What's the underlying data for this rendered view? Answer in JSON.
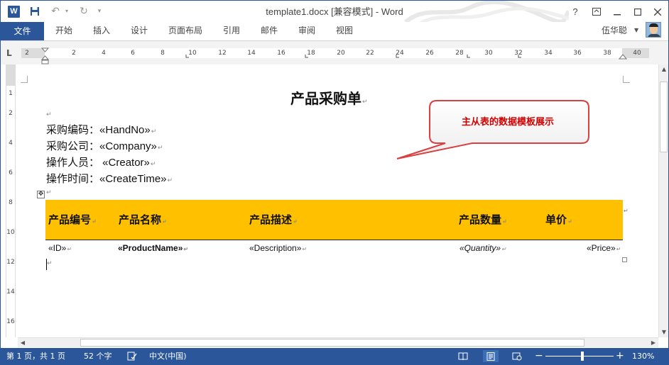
{
  "titlebar": {
    "app_icon": "W",
    "save_icon": "save-icon",
    "undo_icon": "undo-icon",
    "redo_icon": "redo-icon",
    "document_title": "template1.docx [兼容模式] - Word",
    "help": "?",
    "restore_ribbon_icon": "ribbon-display-icon",
    "minimize_icon": "minimize-icon",
    "maximize_icon": "maximize-icon",
    "close_icon": "close-icon"
  },
  "ribbon": {
    "file_tab": "文件",
    "tabs": [
      "开始",
      "插入",
      "设计",
      "页面布局",
      "引用",
      "邮件",
      "审阅",
      "视图"
    ],
    "user_name": "伍华聪"
  },
  "ruler": {
    "tab_selector": "L",
    "numbers": [
      "2",
      "2",
      "4",
      "6",
      "8",
      "10",
      "12",
      "14",
      "16",
      "18",
      "20",
      "22",
      "24",
      "26",
      "28",
      "30",
      "32",
      "34",
      "36",
      "38",
      "40"
    ],
    "vertical_numbers": [
      "1",
      "2",
      "4",
      "6",
      "8",
      "10",
      "12",
      "14",
      "16"
    ]
  },
  "document": {
    "heading": "产品采购单",
    "fields": [
      {
        "label": "采购编码：",
        "value": "«HandNo»"
      },
      {
        "label": "采购公司：",
        "value": "«Company»"
      },
      {
        "label": "操作人员：",
        "value": " «Creator»"
      },
      {
        "label": "操作时间：",
        "value": "«CreateTime»"
      }
    ],
    "paragraph_mark": "↵",
    "callout": "主从表的数据模板展示",
    "table": {
      "headers": [
        "产品编号",
        "产品名称",
        "产品描述",
        "产品数量",
        "单价"
      ],
      "row": [
        "«ID»",
        "«ProductName»",
        "«Description»",
        "«Quantity»",
        "«Price»"
      ]
    }
  },
  "statusbar": {
    "page": "第 1 页，共 1 页",
    "words": "52 个字",
    "proofing_icon": "proofing-icon",
    "language": "中文(中国)",
    "zoom_minus": "−",
    "zoom_plus": "+",
    "zoom": "130%",
    "zoom_level_percent": 130
  },
  "colors": {
    "accent": "#2b579a",
    "table_header": "#ffc000",
    "callout_border": "#d94040",
    "callout_text": "#d40000"
  }
}
